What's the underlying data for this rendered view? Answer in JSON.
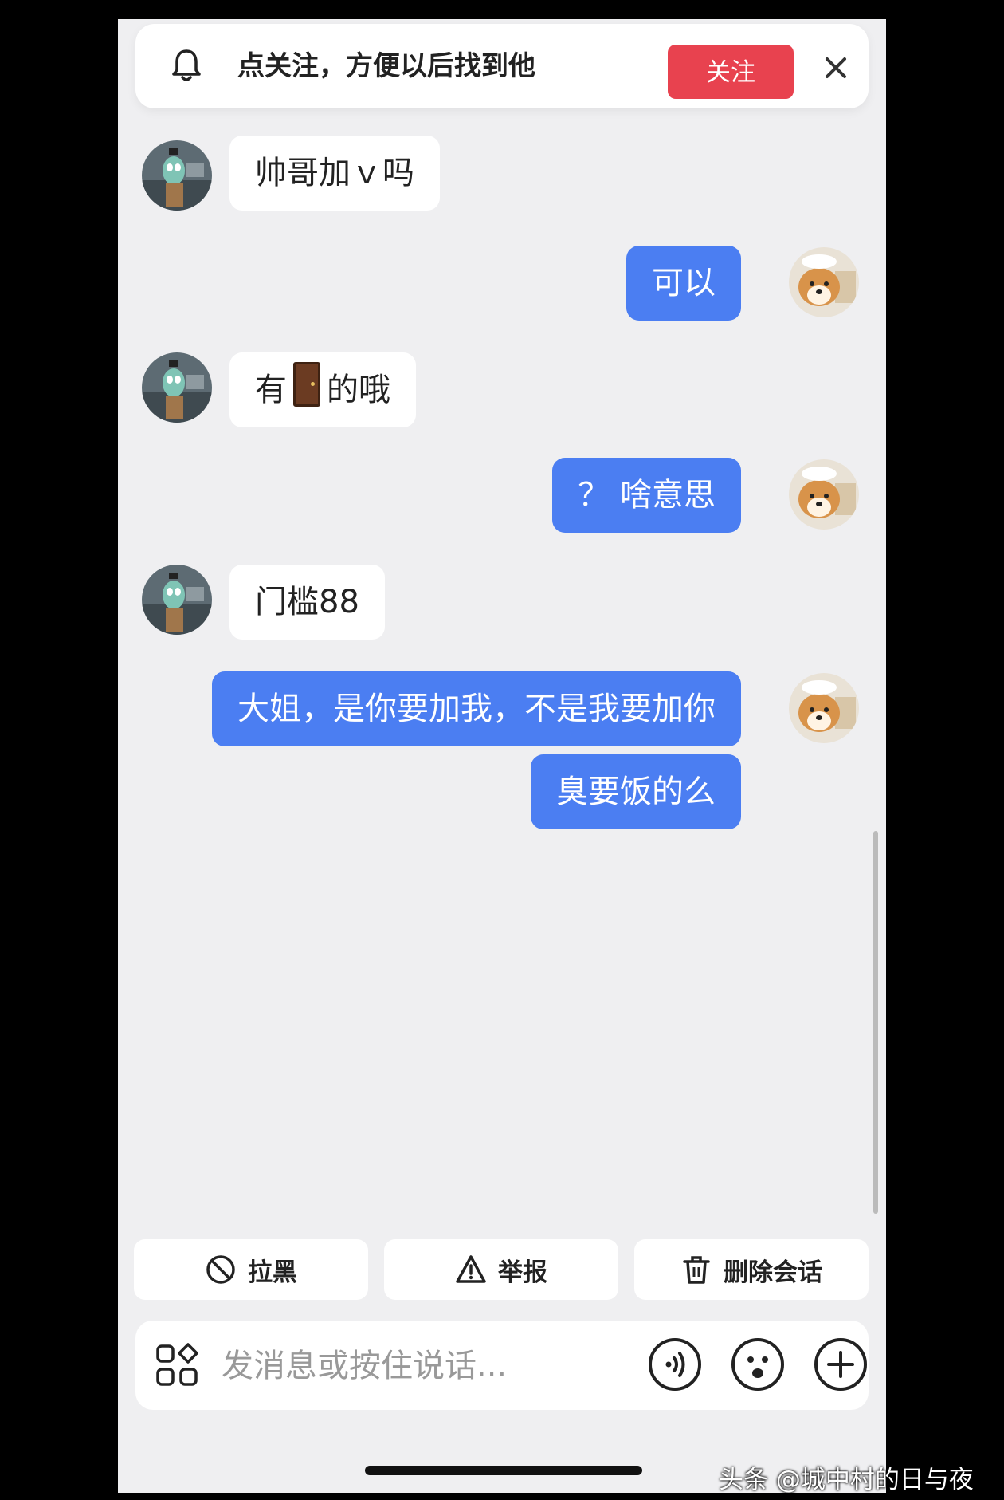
{
  "follow_bar": {
    "prompt": "点关注，方便以后找到他",
    "follow_label": "关注"
  },
  "messages": [
    {
      "side": "in",
      "text": "帅哥加ｖ吗"
    },
    {
      "side": "out",
      "text": "可以"
    },
    {
      "side": "in",
      "text_before": "有",
      "emoji": "door",
      "text_after": "的哦"
    },
    {
      "side": "out",
      "text": "？ 啥意思"
    },
    {
      "side": "in",
      "text": "门槛88"
    },
    {
      "side": "out",
      "text": "大姐，是你要加我，不是我要加你"
    },
    {
      "side": "out",
      "text": "臭要饭的么"
    }
  ],
  "actions": {
    "block_label": "拉黑",
    "report_label": "举报",
    "delete_label": "删除会话"
  },
  "input": {
    "placeholder": "发消息或按住说话..."
  },
  "watermark": "头条 @城中村的日与夜",
  "colors": {
    "accent_blue": "#4b7ef2",
    "follow_red": "#e8424f",
    "background": "#efeff1"
  }
}
